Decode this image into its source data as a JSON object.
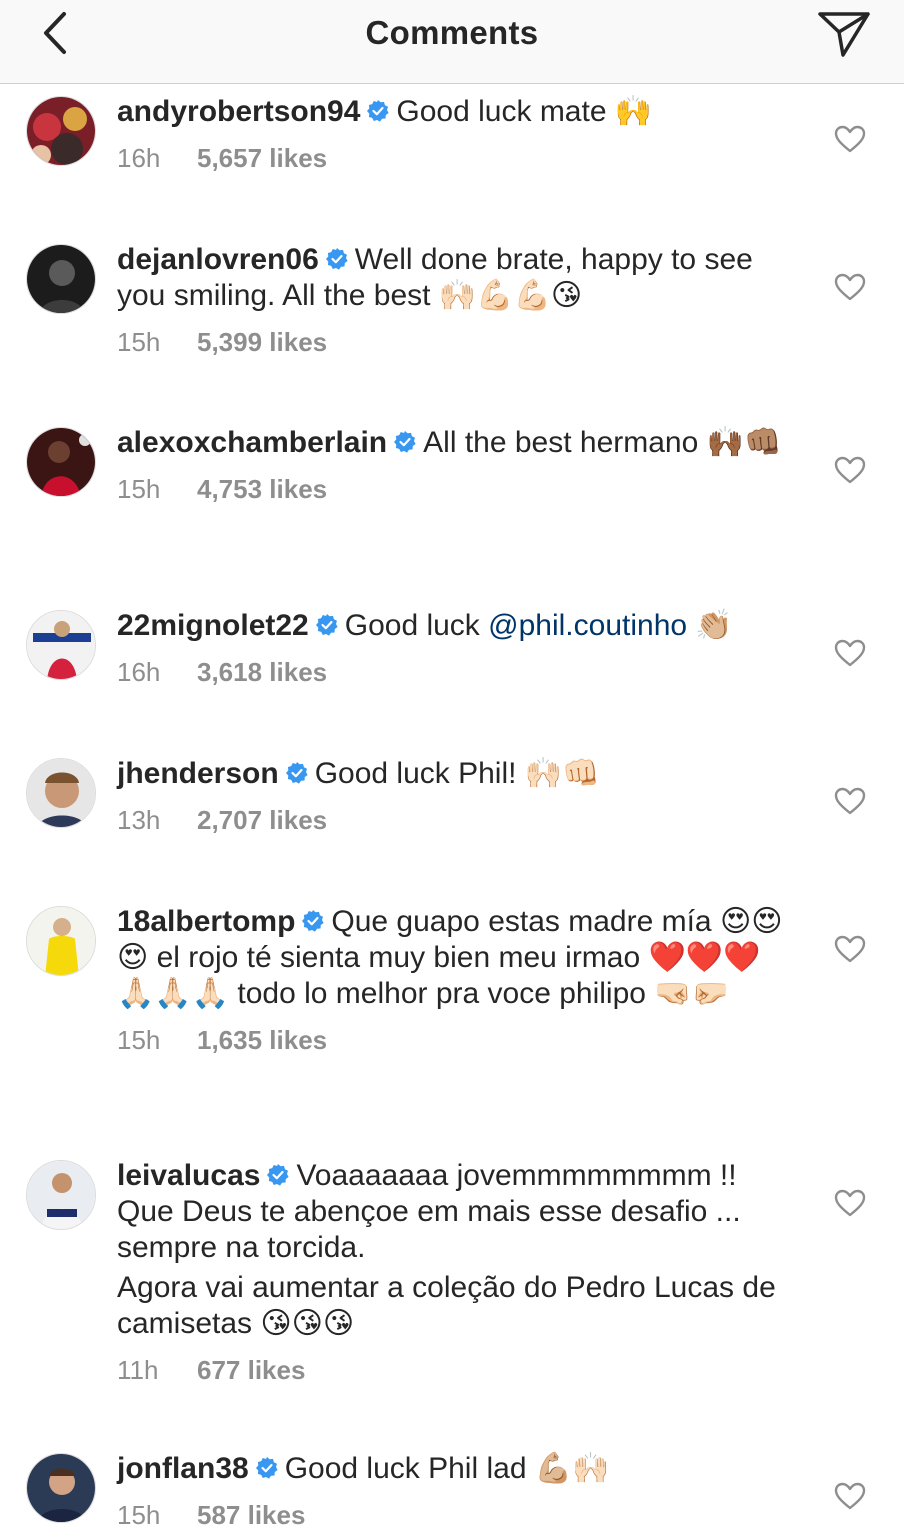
{
  "header": {
    "title": "Comments",
    "back_icon": "chevron-left-icon",
    "send_icon": "paper-plane-icon"
  },
  "colors": {
    "text": "#262626",
    "secondary": "#8e8e8e",
    "verified": "#3897f0",
    "mention": "#003569"
  },
  "comments": [
    {
      "username": "andyrobertson94",
      "verified": true,
      "text": [
        "Good luck mate 🙌"
      ],
      "time": "16h",
      "likes": "5,657 likes"
    },
    {
      "username": "dejanlovren06",
      "verified": true,
      "text": [
        "Well done brate, happy to see you smiling. All the best 🙌🏻💪🏻💪🏻😘"
      ],
      "time": "15h",
      "likes": "5,399 likes"
    },
    {
      "username": "alexoxchamberlain",
      "verified": true,
      "text": [
        "All the best hermano 🙌🏾👊🏽"
      ],
      "time": "15h",
      "likes": "4,753 likes"
    },
    {
      "username": "22mignolet22",
      "verified": true,
      "text_before": "Good luck ",
      "mention": "@phil.coutinho",
      "text_after": " 👏🏼",
      "time": "16h",
      "likes": "3,618 likes"
    },
    {
      "username": "jhenderson",
      "verified": true,
      "text": [
        "Good luck Phil! 🙌🏻👊🏻"
      ],
      "time": "13h",
      "likes": "2,707 likes"
    },
    {
      "username": "18albertomp",
      "verified": true,
      "text": [
        "Que guapo estas madre mía 😍😍😍 el rojo té sienta muy bien meu irmao ❤️❤️❤️🙏🏻🙏🏻🙏🏻 todo lo melhor pra voce philipo 🤜🏻🤛🏻"
      ],
      "time": "15h",
      "likes": "1,635 likes"
    },
    {
      "username": "leivalucas",
      "verified": true,
      "text": [
        "Voaaaaaaa jovemmmmmmmm !! Que Deus te abençoe em mais esse desafio ... sempre na torcida.",
        "Agora vai aumentar a coleção do Pedro Lucas de camisetas 😘😘😘"
      ],
      "time": "11h",
      "likes": "677 likes"
    },
    {
      "username": "jonflan38",
      "verified": true,
      "text": [
        "Good luck Phil lad 💪🏼🙌🏻"
      ],
      "time": "15h",
      "likes": "587 likes"
    }
  ]
}
